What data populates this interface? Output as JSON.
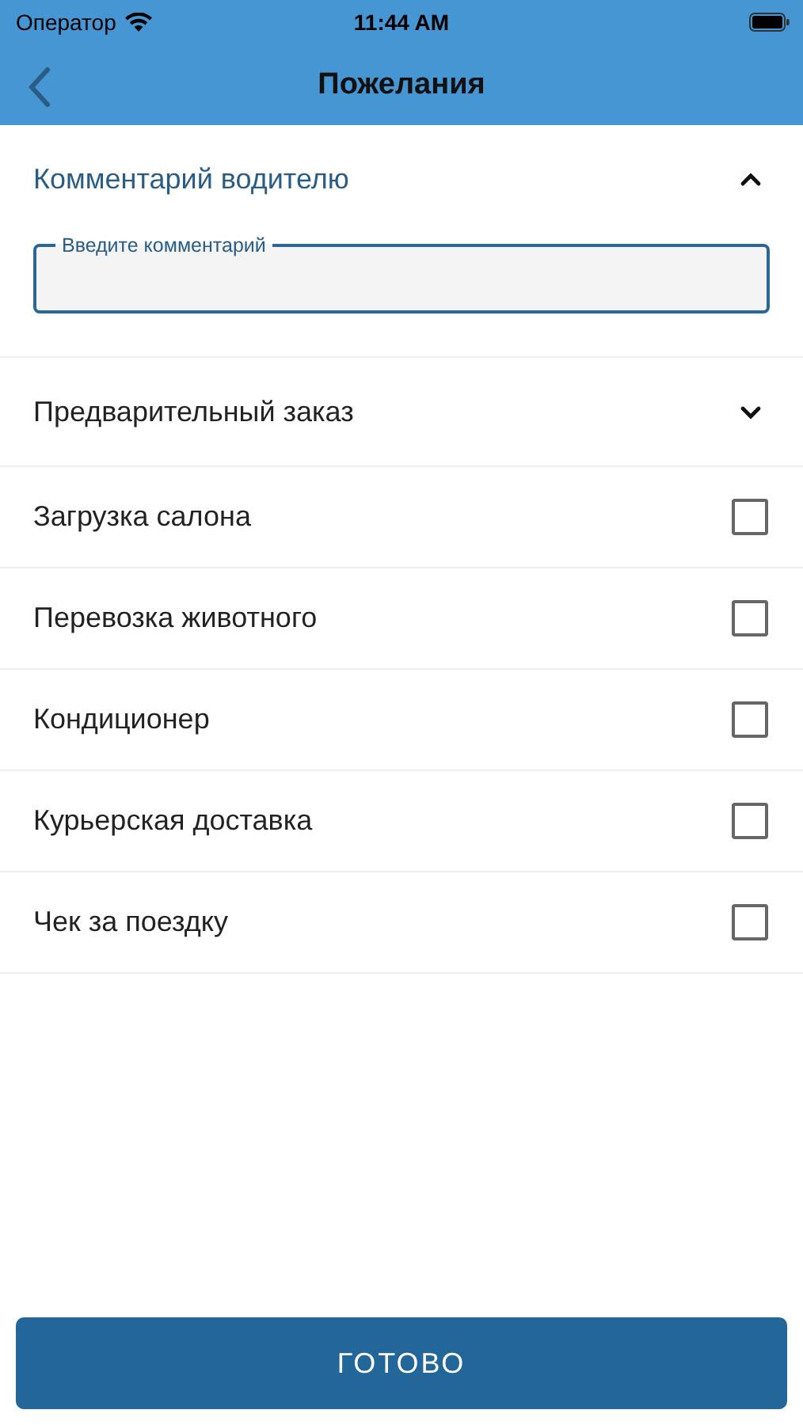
{
  "status_bar": {
    "carrier": "Оператор",
    "time": "11:44 AM"
  },
  "nav": {
    "title": "Пожелания"
  },
  "comment": {
    "title": "Комментарий водителю",
    "expanded": true,
    "field_label": "Введите комментарий"
  },
  "preorder": {
    "title": "Предварительный заказ",
    "expanded": false
  },
  "options": [
    {
      "label": "Загрузка салона",
      "checked": false
    },
    {
      "label": "Перевозка животного",
      "checked": false
    },
    {
      "label": "Кондиционер",
      "checked": false
    },
    {
      "label": "Курьерская доставка",
      "checked": false
    },
    {
      "label": "Чек за поездку",
      "checked": false
    }
  ],
  "done_button": "ГОТОВО"
}
